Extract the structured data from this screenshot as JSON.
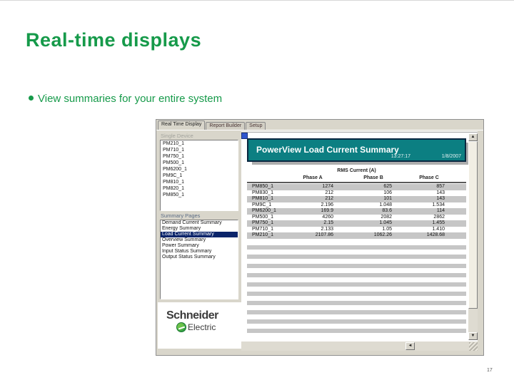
{
  "slide": {
    "title": "Real-time displays",
    "bullet": "View summaries for your entire system",
    "page_number": "17"
  },
  "colors": {
    "title_green": "#169a4a",
    "banner_teal": "#0c7f82",
    "selection_navy": "#0a246a",
    "stripe_gray": "#c6c6c6"
  },
  "app": {
    "tabs": [
      {
        "label": "Real Time Display",
        "active": true
      },
      {
        "label": "Report Builder",
        "active": false
      },
      {
        "label": "Setup",
        "active": false
      }
    ],
    "single_device": {
      "label": "Single Device",
      "items": [
        "PM210_1",
        "PM710_1",
        "PM750_1",
        "PM500_1",
        "PM6200_1",
        "PM9C_1",
        "PM810_1",
        "PM820_1",
        "PM850_1"
      ]
    },
    "summary_pages": {
      "label": "Summary Pages",
      "items": [
        "Demand Current Summary",
        "Energy Summary",
        "Load Current Summary",
        "Overview Summary",
        "Power Summary",
        "Input Status Summary",
        "Output Status Summary"
      ],
      "selected": "Load Current Summary"
    },
    "logo": {
      "brand_top": "Schneider",
      "brand_bottom": "Electric"
    },
    "report": {
      "title": "PowerView Load Current Summary",
      "time": "13:27:17",
      "date": "1/8/2007",
      "unit_header": "RMS Current (A)",
      "columns": [
        "Phase A",
        "Phase B",
        "Phase C"
      ],
      "rows": [
        {
          "device": "PM850_1",
          "phase_a": "1274",
          "phase_b": "625",
          "phase_c": "857"
        },
        {
          "device": "PM830_1",
          "phase_a": "212",
          "phase_b": "106",
          "phase_c": "143"
        },
        {
          "device": "PM810_1",
          "phase_a": "212",
          "phase_b": "101",
          "phase_c": "143"
        },
        {
          "device": "PM9C_1",
          "phase_a": "2.196",
          "phase_b": "1.048",
          "phase_c": "1.534"
        },
        {
          "device": "PM6200_1",
          "phase_a": "169.9",
          "phase_b": "83.6",
          "phase_c": "114"
        },
        {
          "device": "PM500_1",
          "phase_a": "4260",
          "phase_b": "2082",
          "phase_c": "2862"
        },
        {
          "device": "PM750_1",
          "phase_a": "2.15",
          "phase_b": "1.045",
          "phase_c": "1.455"
        },
        {
          "device": "PM710_1",
          "phase_a": "2.133",
          "phase_b": "1.05",
          "phase_c": "1.410"
        },
        {
          "device": "PM210_1",
          "phase_a": "2107.86",
          "phase_b": "1062.26",
          "phase_c": "1428.68"
        }
      ]
    }
  }
}
